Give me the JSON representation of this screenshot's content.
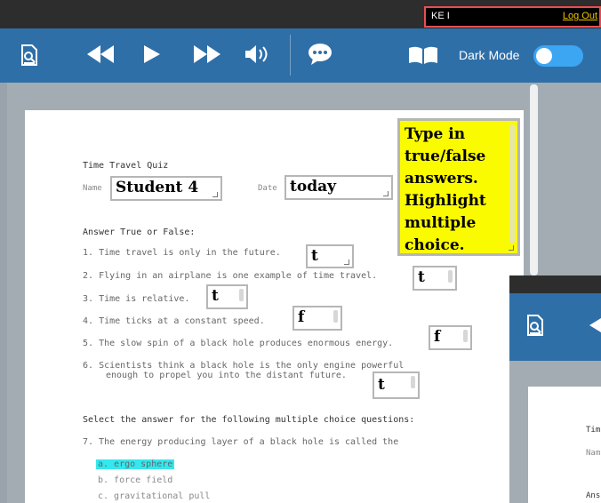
{
  "header": {
    "user_name": "KE I",
    "logout": "Log Out"
  },
  "toolbar": {
    "dark_mode_label": "Dark Mode",
    "dark_mode_on": true,
    "icons": [
      "review-doc-icon",
      "rewind-icon",
      "play-icon",
      "fast-forward-icon",
      "volume-icon",
      "chat-icon",
      "book-icon"
    ]
  },
  "quiz": {
    "title": "Time Travel Quiz",
    "name_label": "Name",
    "name_value": "Student 4",
    "date_label": "Date",
    "date_value": "today",
    "tf_heading": "Answer True or False:",
    "questions": [
      {
        "num": "1.",
        "text": "Time travel is only in the future.",
        "answer": "t"
      },
      {
        "num": "2.",
        "text": "Flying in an airplane is one example of time travel.",
        "answer": "t"
      },
      {
        "num": "3.",
        "text": "Time is relative.",
        "answer": "t"
      },
      {
        "num": "4.",
        "text": "Time ticks at a constant speed.",
        "answer": "f"
      },
      {
        "num": "5.",
        "text": "The slow spin of a black hole produces enormous energy.",
        "answer": "f"
      },
      {
        "num": "6.",
        "text": "Scientists think a black hole is the only engine powerful",
        "text2": "enough to propel you into the distant future.",
        "answer": "t"
      }
    ],
    "mc_heading": "Select the answer for the following multiple choice questions:",
    "mc_question": "7. The energy producing layer of a black hole is called the",
    "mc_options": [
      "a. ergo sphere",
      "b. force field",
      "c. gravitational pull"
    ]
  },
  "sticky_note": {
    "text": "Type in true/false answers. Highlight multiple choice."
  },
  "second_window": {
    "doc_lines": [
      "Tim",
      "Nam",
      "Ans"
    ]
  },
  "colors": {
    "toolbar": "#2f6fa8",
    "highlight": "#34e8ef",
    "note": "#fbfb00"
  }
}
